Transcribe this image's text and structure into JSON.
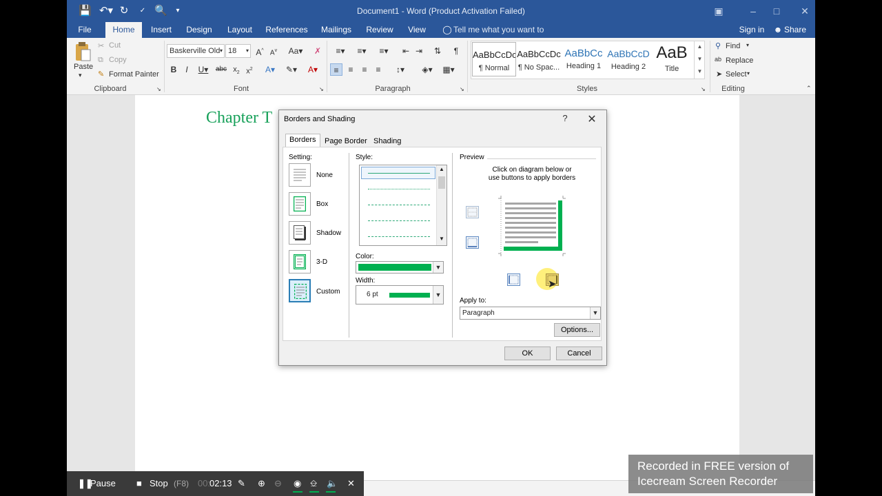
{
  "window": {
    "title": "Document1 - Word (Product Activation Failed)"
  },
  "tabs": [
    "File",
    "Home",
    "Insert",
    "Design",
    "Layout",
    "References",
    "Mailings",
    "Review",
    "View"
  ],
  "tell_me": "Tell me what you want to do...",
  "signin": "Sign in",
  "share": "Share",
  "clipboard": {
    "paste": "Paste",
    "cut": "Cut",
    "copy": "Copy",
    "format_painter": "Format Painter",
    "label": "Clipboard"
  },
  "font": {
    "name": "Baskerville Old",
    "size": "18",
    "label": "Font"
  },
  "paragraph": {
    "label": "Paragraph"
  },
  "styles": {
    "label": "Styles",
    "items": [
      {
        "preview": "AaBbCcDc",
        "name": "¶ Normal"
      },
      {
        "preview": "AaBbCcDc",
        "name": "¶ No Spac..."
      },
      {
        "preview": "AaBbCc",
        "name": "Heading 1"
      },
      {
        "preview": "AaBbCcD",
        "name": "Heading 2"
      },
      {
        "preview": "AaB",
        "name": "Title"
      }
    ]
  },
  "editing": {
    "find": "Find",
    "replace": "Replace",
    "select": "Select",
    "label": "Editing"
  },
  "document": {
    "heading_text": "Chapter T"
  },
  "dialog": {
    "title": "Borders and Shading",
    "help": "?",
    "tabs": [
      "Borders",
      "Page Border",
      "Shading"
    ],
    "setting_label": "Setting:",
    "settings": [
      "None",
      "Box",
      "Shadow",
      "3-D",
      "Custom"
    ],
    "style_label": "Style:",
    "color_label": "Color:",
    "width_label": "Width:",
    "width_value": "6 pt",
    "border_color": "#00b050",
    "preview_label": "Preview",
    "preview_hint_1": "Click on diagram below or",
    "preview_hint_2": "use buttons to apply borders",
    "apply_to_label": "Apply to:",
    "apply_to_value": "Paragraph",
    "options_button": "Options...",
    "ok_button": "OK",
    "cancel_button": "Cancel"
  },
  "recorder": {
    "pause": "Pause",
    "stop": "Stop",
    "stop_key": "(F8)",
    "time_dim": "00:",
    "time": "02:13"
  },
  "watermark": {
    "line1": "Recorded in FREE version of",
    "line2": "Icecream  Screen  Recorder"
  }
}
